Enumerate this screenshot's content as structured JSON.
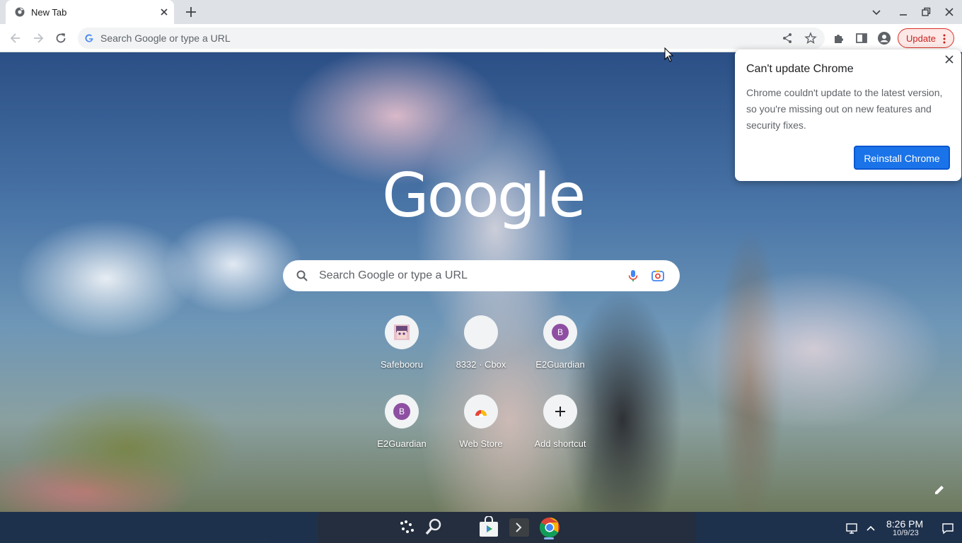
{
  "tab": {
    "title": "New Tab"
  },
  "omnibox": {
    "placeholder": "Search Google or type a URL"
  },
  "toolbar": {
    "update_label": "Update"
  },
  "ntp": {
    "logo": "Google",
    "search_placeholder": "Search Google or type a URL",
    "shortcuts": [
      {
        "label": "Safebooru",
        "icon": "safebooru-favicon"
      },
      {
        "label": "8332 · Cbox",
        "icon": "blank-favicon"
      },
      {
        "label": "E2Guardian",
        "icon": "letter-avatar",
        "letter": "B"
      },
      {
        "label": "E2Guardian",
        "icon": "letter-avatar",
        "letter": "B"
      },
      {
        "label": "Web Store",
        "icon": "web-store-icon"
      },
      {
        "label": "Add shortcut",
        "icon": "plus-icon"
      }
    ]
  },
  "popup": {
    "title": "Can't update Chrome",
    "body": "Chrome couldn't update to the latest version, so you're missing out on new features and security fixes.",
    "button": "Reinstall Chrome"
  },
  "tray": {
    "time": "8:26 PM",
    "date": "10/9/23"
  },
  "colors": {
    "accent": "#1a73e8",
    "update_red": "#d93025",
    "avatar_purple": "#8e4fa3"
  }
}
